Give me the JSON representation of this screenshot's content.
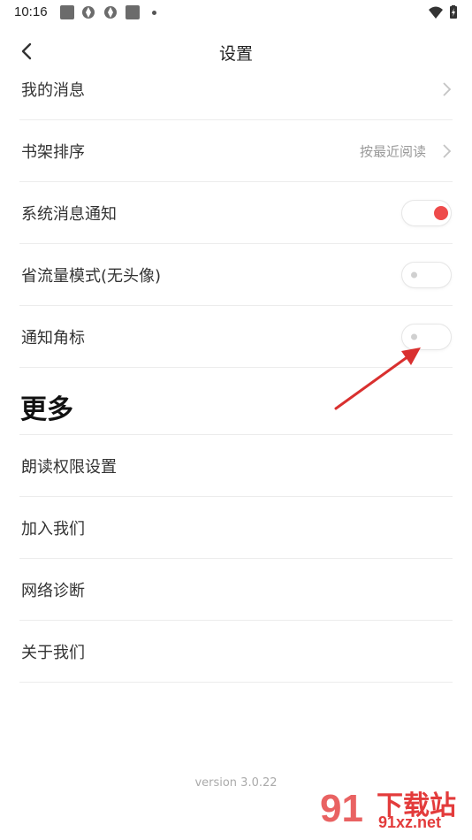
{
  "status_bar": {
    "time": "10:16"
  },
  "nav": {
    "title": "设置"
  },
  "settings": [
    {
      "label": "我的消息",
      "type": "link"
    },
    {
      "label": "书架排序",
      "type": "link",
      "value": "按最近阅读"
    },
    {
      "label": "系统消息通知",
      "type": "toggle",
      "on": true
    },
    {
      "label": "省流量模式(无头像)",
      "type": "toggle",
      "on": false
    },
    {
      "label": "通知角标",
      "type": "toggle",
      "on": false
    }
  ],
  "more": {
    "title": "更多",
    "items": [
      "朗读权限设置",
      "加入我们",
      "网络诊断",
      "关于我们"
    ]
  },
  "footer": {
    "version": "version 3.0.22"
  },
  "watermark": {
    "number": "91",
    "title": "下载站",
    "site": "91xz.net"
  },
  "colors": {
    "toggle_on": "#ee4b4b",
    "annotation_arrow": "#d9302f"
  }
}
